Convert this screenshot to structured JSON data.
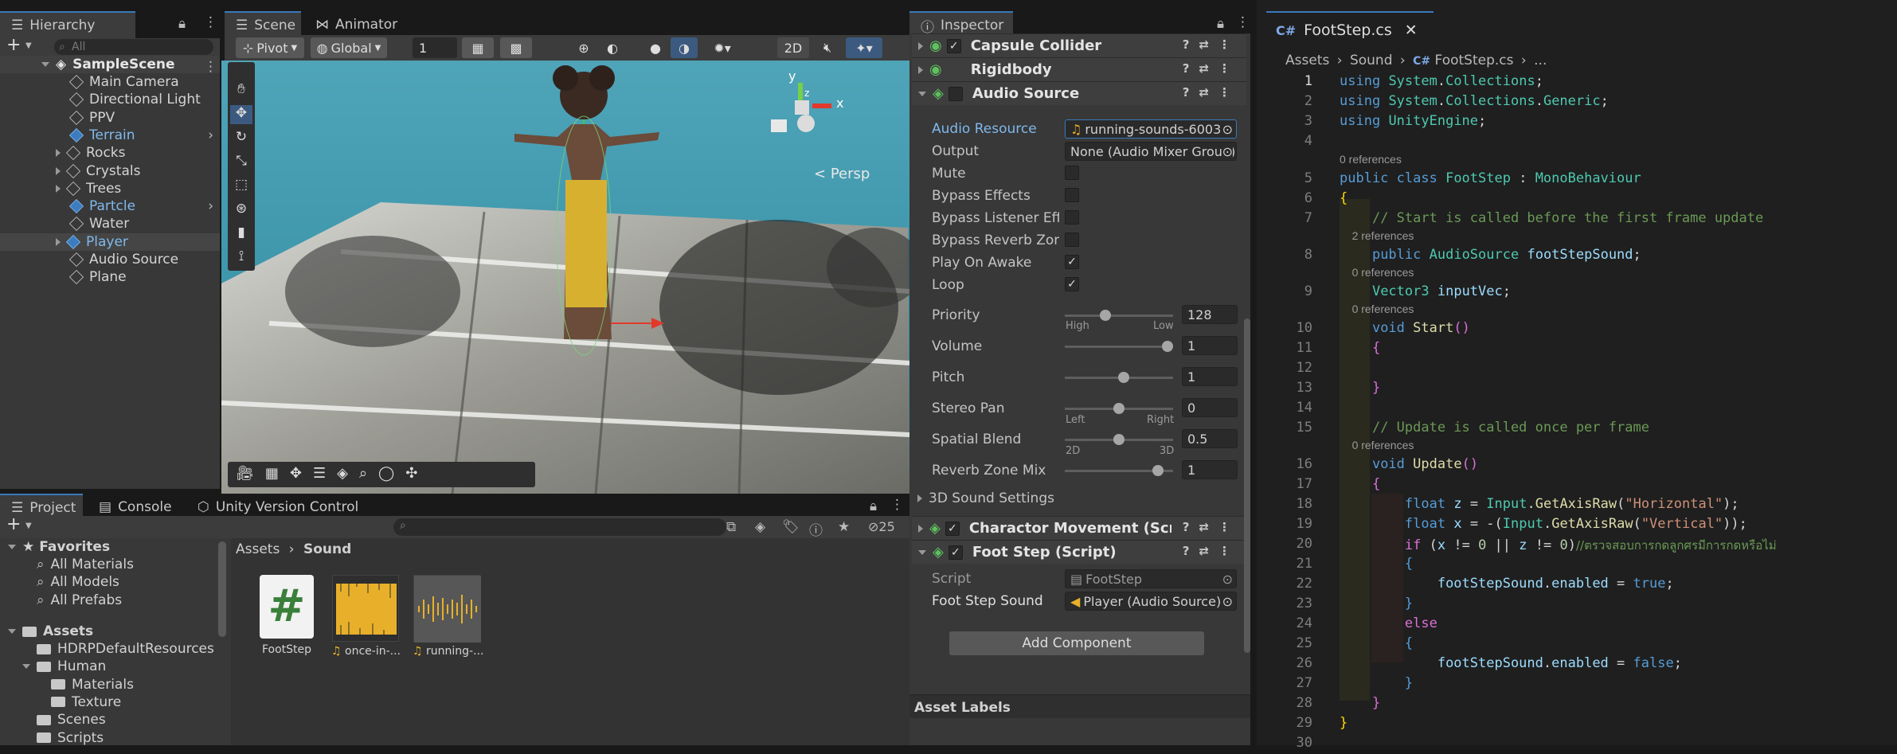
{
  "hierarchy": {
    "tab": "Hierarchy",
    "search_placeholder": "All",
    "scene": "SampleScene",
    "items": [
      {
        "label": "Main Camera",
        "blue": false
      },
      {
        "label": "Directional Light",
        "blue": false
      },
      {
        "label": "PPV",
        "blue": false
      },
      {
        "label": "Terrain",
        "blue": true
      },
      {
        "label": "Rocks",
        "blue": false
      },
      {
        "label": "Crystals",
        "blue": false
      },
      {
        "label": "Trees",
        "blue": false
      },
      {
        "label": "Partcle",
        "blue": true
      },
      {
        "label": "Water",
        "blue": false
      },
      {
        "label": "Player",
        "blue": true
      },
      {
        "label": "Audio Source",
        "blue": false
      },
      {
        "label": "Plane",
        "blue": false
      }
    ]
  },
  "scene_view": {
    "tab_scene": "Scene",
    "tab_animator": "Animator",
    "pivot": "Pivot",
    "global": "Global",
    "layer": "1",
    "mode_2d": "2D",
    "persp": "Persp",
    "gizmo_y": "y",
    "gizmo_x": "x",
    "gizmo_z": "z"
  },
  "project": {
    "tab_project": "Project",
    "tab_console": "Console",
    "tab_uvc": "Unity Version Control",
    "hidden_count": "25",
    "favorites_label": "Favorites",
    "favorites": [
      "All Materials",
      "All Models",
      "All Prefabs"
    ],
    "assets_label": "Assets",
    "folders": [
      "HDRPDefaultResources",
      "Human",
      "Materials",
      "Texture",
      "Scenes",
      "Scripts"
    ],
    "breadcrumb_root": "Assets",
    "breadcrumb_current": "Sound",
    "files": [
      {
        "name": "FootStep",
        "kind": "script"
      },
      {
        "name": "once-in-...",
        "kind": "audio"
      },
      {
        "name": "running-...",
        "kind": "audio"
      }
    ]
  },
  "inspector": {
    "tab": "Inspector",
    "components": {
      "capsule": "Capsule Collider",
      "rigidbody": "Rigidbody",
      "audio_source": "Audio Source",
      "charactor": "Charactor Movement (Script)",
      "footstep": "Foot Step (Script)"
    },
    "audio": {
      "resource_label": "Audio Resource",
      "resource_value": "running-sounds-6003",
      "output_label": "Output",
      "output_value": "None (Audio Mixer Group)",
      "mute": "Mute",
      "bypass_effects": "Bypass Effects",
      "bypass_listener": "Bypass Listener Effects",
      "bypass_reverb": "Bypass Reverb Zones",
      "play_on_awake": "Play On Awake",
      "loop": "Loop",
      "priority_label": "Priority",
      "priority_value": "128",
      "priority_level": 0.36,
      "priority_min": "High",
      "priority_max": "Low",
      "volume_label": "Volume",
      "volume_value": "1",
      "volume_level": 1.0,
      "pitch_label": "Pitch",
      "pitch_value": "1",
      "pitch_level": 0.55,
      "stereo_label": "Stereo Pan",
      "stereo_value": "0",
      "stereo_level": 0.5,
      "stereo_min": "Left",
      "stereo_max": "Right",
      "spatial_label": "Spatial Blend",
      "spatial_value": "0.5",
      "spatial_level": 0.5,
      "spatial_min": "2D",
      "spatial_max": "3D",
      "reverb_label": "Reverb Zone Mix",
      "reverb_value": "1",
      "reverb_level": 0.9,
      "settings_3d": "3D Sound Settings"
    },
    "footstep": {
      "script_label": "Script",
      "script_value": "FootStep",
      "sound_label": "Foot Step Sound",
      "sound_value": "Player (Audio Source)"
    },
    "add_component": "Add Component",
    "asset_labels": "Asset Labels"
  },
  "editor": {
    "tab": "FootStep.cs",
    "breadcrumb": [
      "Assets",
      "Sound",
      "FootStep.cs",
      "..."
    ],
    "ref0": "0 references",
    "ref2": "2 references",
    "comment_start": "// Start is called before the first frame update",
    "comment_update": "// Update is called once per frame",
    "comment_thai": "//ตรวจสอบการกดลูกศรมีการกดหรือไม่"
  }
}
